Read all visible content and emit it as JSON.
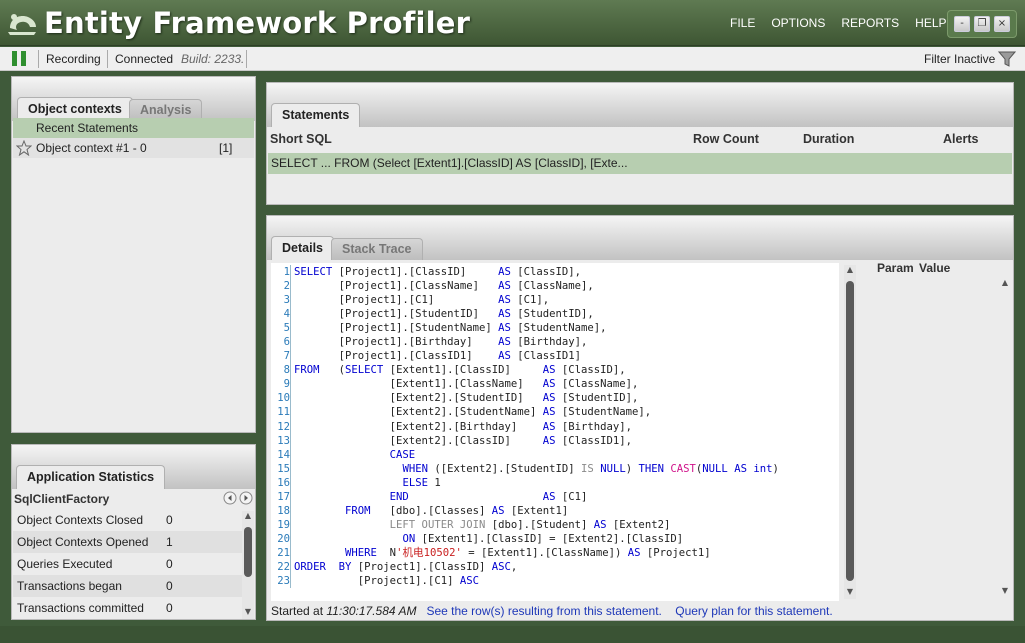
{
  "app": {
    "title": "Entity Framework Profiler"
  },
  "menu": [
    "FILE",
    "OPTIONS",
    "REPORTS",
    "HELP"
  ],
  "window_controls": {
    "minimize": "-",
    "restore": "❐",
    "close": "×"
  },
  "toolbar": {
    "recording": "Recording",
    "connected": "Connected",
    "build": "Build: 2233.",
    "filter": "Filter Inactive"
  },
  "left_panel": {
    "tabs": [
      "Object contexts",
      "Analysis"
    ],
    "recent": "Recent Statements",
    "context_name": "Object context #1 - 0",
    "context_count": "[1]"
  },
  "app_stats": {
    "tab": "Application Statistics",
    "factory": "SqlClientFactory",
    "rows": [
      {
        "label": "Object Contexts Closed",
        "value": "0"
      },
      {
        "label": "Object Contexts Opened",
        "value": "1"
      },
      {
        "label": "Queries Executed",
        "value": "0"
      },
      {
        "label": "Transactions began",
        "value": "0"
      },
      {
        "label": "Transactions committed",
        "value": "0"
      }
    ]
  },
  "statements": {
    "tab": "Statements",
    "columns": [
      "Short SQL",
      "Row Count",
      "Duration",
      "Alerts"
    ],
    "row": "SELECT ... FROM (Select [Extent1].[ClassID] AS [ClassID], [Exte..."
  },
  "details": {
    "tabs": [
      "Details",
      "Stack Trace"
    ],
    "line_numbers": [
      "1",
      "2",
      "3",
      "4",
      "5",
      "6",
      "7",
      "8",
      "9",
      "10",
      "11",
      "12",
      "13",
      "14",
      "15",
      "16",
      "17",
      "18",
      "19",
      "20",
      "21",
      "22",
      "23"
    ],
    "param_headers": [
      "Param",
      "Value"
    ],
    "started_label": "Started at",
    "started_time": "11:30:17.584 AM",
    "link_rows": "See the  row(s) resulting from this statement.",
    "link_plan": "Query plan for this statement."
  },
  "colors": {
    "title_bar": "#4f6b44",
    "selection": "#b7ceb0",
    "keyword": "#0000d0",
    "function": "#d0148b",
    "string": "#c81e1e",
    "comment_gray": "#8a8a8a",
    "link": "#1e38b8"
  }
}
